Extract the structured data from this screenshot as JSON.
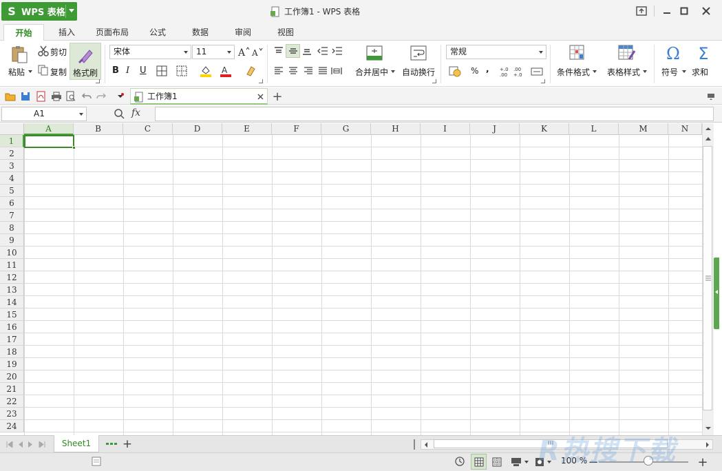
{
  "app": {
    "name": "WPS 表格",
    "logo_letter": "S"
  },
  "window": {
    "title": "工作簿1 - WPS 表格"
  },
  "tabs": [
    {
      "label": "开始",
      "active": true
    },
    {
      "label": "插入"
    },
    {
      "label": "页面布局"
    },
    {
      "label": "公式"
    },
    {
      "label": "数据"
    },
    {
      "label": "审阅"
    },
    {
      "label": "视图"
    }
  ],
  "ribbon": {
    "paste": "粘贴",
    "cut": "剪切",
    "copy": "复制",
    "format_painter": "格式刷",
    "font_name": "宋体",
    "font_size": "11",
    "merge_center": "合并居中",
    "wrap_text": "自动换行",
    "number_format": "常规",
    "conditional_format": "条件格式",
    "table_style": "表格样式",
    "symbol": "符号",
    "sum": "求和",
    "bold": "B",
    "italic": "I",
    "underline": "U",
    "percent": "%",
    "comma": ","
  },
  "doc_tab": {
    "label": "工作簿1"
  },
  "formula_bar": {
    "name_box": "A1",
    "fx": "fx",
    "value": ""
  },
  "columns": [
    "A",
    "B",
    "C",
    "D",
    "E",
    "F",
    "G",
    "H",
    "I",
    "J",
    "K",
    "L",
    "M",
    "N"
  ],
  "rows": [
    "1",
    "2",
    "3",
    "4",
    "5",
    "6",
    "7",
    "8",
    "9",
    "10",
    "11",
    "12",
    "13",
    "14",
    "15",
    "16",
    "17",
    "18",
    "19",
    "20",
    "21",
    "22",
    "23",
    "24"
  ],
  "sheets": [
    {
      "name": "Sheet1",
      "active": true
    }
  ],
  "status": {
    "zoom": "100 %"
  },
  "watermark": "R热搜下载",
  "colors": {
    "accent": "#3e9a34",
    "selection": "#3a8a2a"
  }
}
